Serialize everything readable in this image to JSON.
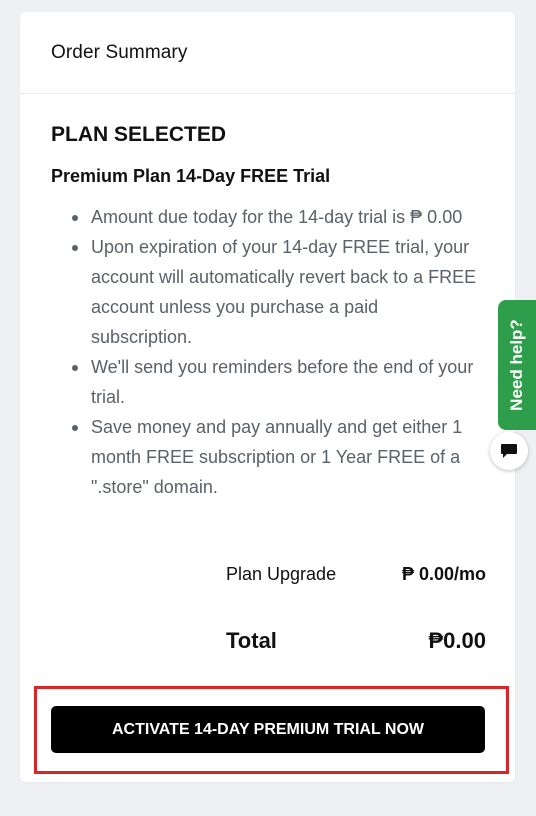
{
  "order_summary": {
    "title": "Order Summary",
    "plan_heading": "PLAN SELECTED",
    "plan_name": "Premium Plan 14-Day FREE Trial",
    "bullets": [
      "Amount due today for the 14-day trial is ₱ 0.00",
      "Upon expiration of your 14-day FREE trial, your account will automatically revert back to a FREE account unless you purchase a paid subscription.",
      "We'll send you reminders before the end of your trial.",
      "Save money and pay annually and get either 1 month FREE subscription or 1 Year FREE of a \".store\" domain."
    ],
    "plan_upgrade_label": "Plan Upgrade",
    "plan_upgrade_amount": "₱ 0.00/mo",
    "total_label": "Total",
    "total_amount": "₱0.00",
    "cta_label": "ACTIVATE 14-DAY PREMIUM TRIAL NOW"
  },
  "help_widget": {
    "label": "Need help?",
    "chat_icon": "chat-bubble-icon"
  },
  "colors": {
    "background": "#eef0f3",
    "card": "#ffffff",
    "cta": "#000000",
    "highlight": "#d8262b",
    "help_tab": "#2e9e4c",
    "bullet_text": "#5a6168"
  }
}
